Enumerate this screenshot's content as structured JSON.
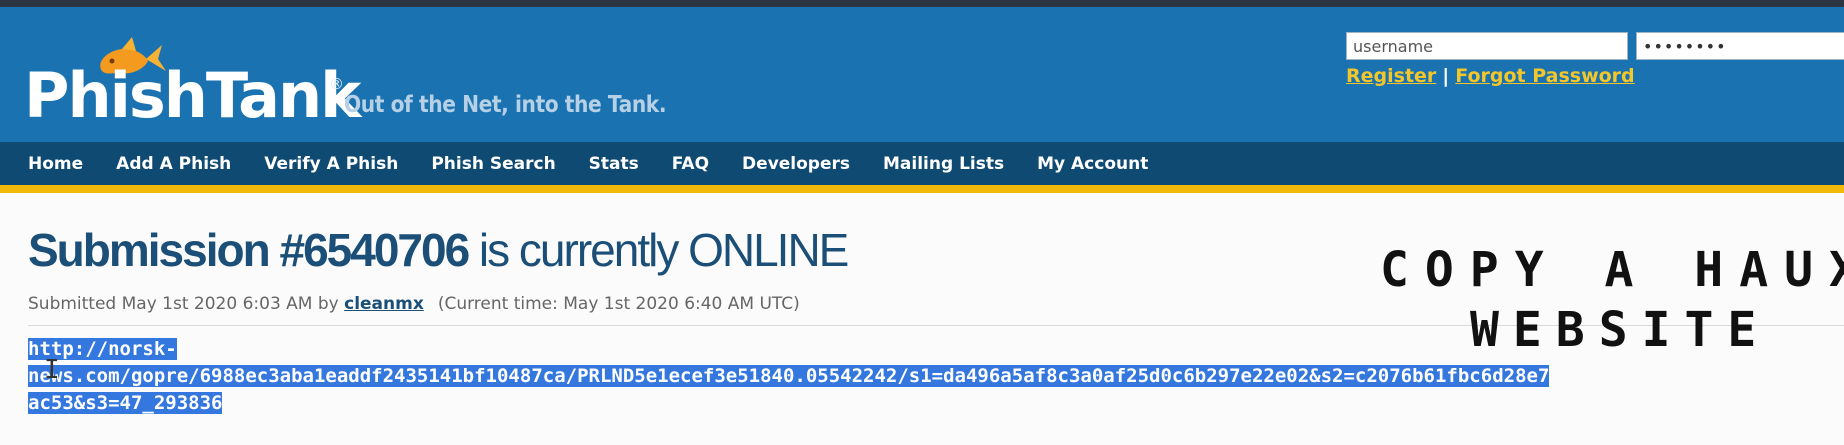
{
  "header": {
    "logo_text": "PhishTank",
    "registered_mark": "®",
    "tagline": "Out of the Net, into the Tank.",
    "login": {
      "username_value": "username",
      "password_value": "••••••••",
      "register_link": "Register",
      "separator": "|",
      "forgot_link": "Forgot Password"
    }
  },
  "nav": {
    "items": [
      {
        "label": "Home"
      },
      {
        "label": "Add A Phish"
      },
      {
        "label": "Verify A Phish"
      },
      {
        "label": "Phish Search"
      },
      {
        "label": "Stats"
      },
      {
        "label": "FAQ"
      },
      {
        "label": "Developers"
      },
      {
        "label": "Mailing Lists"
      },
      {
        "label": "My Account"
      }
    ]
  },
  "submission": {
    "title_number": "Submission #6540706",
    "title_status": " is currently ONLINE",
    "submitted_prefix": "Submitted May 1st 2020 6:03 AM by ",
    "submitter": "cleanmx",
    "current_time": "(Current time: May 1st 2020 6:40 AM UTC)",
    "url_line1": "http://norsk-",
    "url_line2": "news.com/gopre/6988ec3aba1eaddf2435141bf10487ca/PRLND5e1ecef3e51840.05542242/s1=da496a5af8c3a0af25d0c6b297e22e02&s2=c2076b61fbc6d28e7",
    "url_line3": "ac53&s3=47_293836"
  },
  "overlay": {
    "line1": "COPY A HAUX",
    "line2": "WEBSITE"
  },
  "colors": {
    "header_blue": "#1a73b0",
    "nav_blue": "#0f4a72",
    "accent_yellow": "#f0b90b",
    "title_blue": "#1b4f77",
    "selection_blue": "#3477df"
  },
  "icons": {
    "logo_fish": "fish-icon",
    "text_cursor": "text-cursor-icon"
  }
}
